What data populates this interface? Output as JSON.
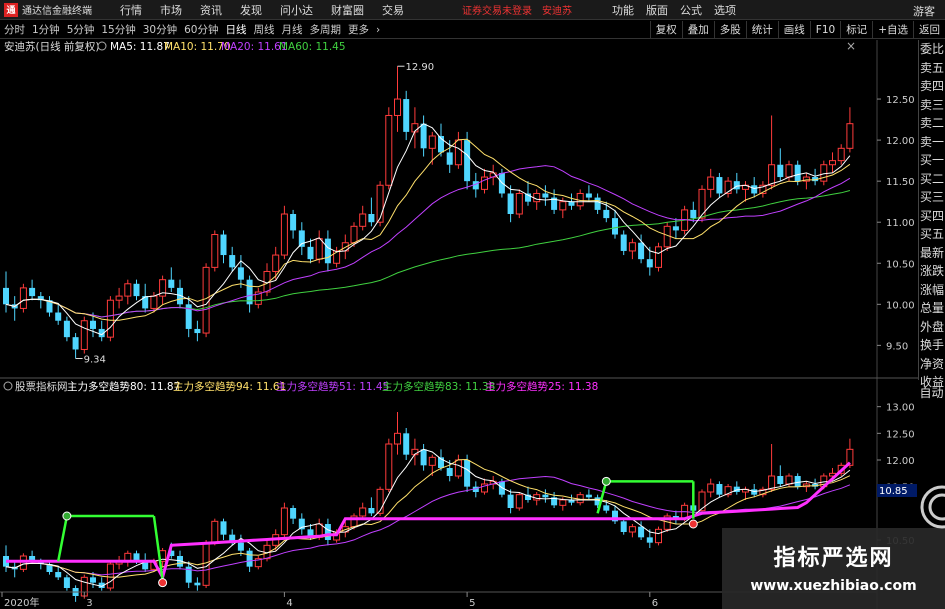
{
  "menu": {
    "app_title": "通达信金融终端",
    "items": [
      "行情",
      "市场",
      "资讯",
      "发现",
      "问小达",
      "财富圈",
      "交易"
    ],
    "trade_login": "证券交易未登录",
    "stock_link": "安迪苏",
    "right_items": [
      "功能",
      "版面",
      "公式",
      "选项"
    ],
    "guest": "游客"
  },
  "toolbar": {
    "periods": [
      "分时",
      "1分钟",
      "5分钟",
      "15分钟",
      "30分钟",
      "60分钟",
      "日线",
      "周线",
      "月线",
      "多周期",
      "更多"
    ],
    "active_period": "日线",
    "right_buttons": [
      "复权",
      "叠加",
      "多股",
      "统计",
      "画线",
      "F10",
      "标记",
      "+自选",
      "返回"
    ]
  },
  "main_legend": {
    "title": "安迪苏(日线 前复权)",
    "ma5": "MA5: 11.87",
    "ma10": "MA10: 11.70",
    "ma20": "MA20: 11.61",
    "ma60": "MA60: 11.45",
    "high_label": "12.90",
    "low_label": "9.34",
    "y_labels": [
      "12.50",
      "12.00",
      "11.50",
      "11.00",
      "10.50",
      "10.00",
      "9.50"
    ]
  },
  "sub_legend": {
    "title": "股票指标网",
    "l1": "主力多空趋势80: 11.87",
    "l2": "主力多空趋势94: 11.61",
    "l3": "主力多空趋势51: 11.45",
    "l4": "主力多空趋势83: 11.38",
    "l5": "主力多空趋势25: 11.38",
    "y_labels": [
      "13.00",
      "12.50",
      "12.00",
      "11.50",
      "10.50"
    ],
    "current_value": "10.85"
  },
  "x_axis": [
    "2020年",
    "3",
    "4",
    "5",
    "6"
  ],
  "sidebar": [
    "委比",
    "卖五",
    "卖四",
    "卖三",
    "卖二",
    "卖一",
    "买一",
    "买二",
    "买三",
    "买四",
    "买五",
    "最新",
    "涨跌",
    "涨幅",
    "总量",
    "外盘",
    "换手",
    "净资",
    "收益"
  ],
  "sub_auto": "自动",
  "watermark": {
    "title": "指标严选网",
    "url": "www.xuezhibiao.com"
  },
  "colors": {
    "up": "#ff3b3b",
    "down": "#4fd6ff",
    "ma5": "#ffffff",
    "ma10": "#ffe06b",
    "ma20": "#c040ff",
    "ma60": "#40d040",
    "magenta": "#ff30ff",
    "green_line": "#33ff33"
  },
  "chart_data": {
    "type": "candlestick",
    "ohlc": [
      [
        10.2,
        10.4,
        9.9,
        10.0
      ],
      [
        10.0,
        10.1,
        9.8,
        9.95
      ],
      [
        9.95,
        10.25,
        9.9,
        10.2
      ],
      [
        10.2,
        10.3,
        10.05,
        10.1
      ],
      [
        10.1,
        10.15,
        9.95,
        10.05
      ],
      [
        10.05,
        10.1,
        9.85,
        9.9
      ],
      [
        9.9,
        10.0,
        9.75,
        9.8
      ],
      [
        9.8,
        9.85,
        9.55,
        9.6
      ],
      [
        9.6,
        9.65,
        9.34,
        9.45
      ],
      [
        9.45,
        9.85,
        9.4,
        9.8
      ],
      [
        9.8,
        9.9,
        9.6,
        9.7
      ],
      [
        9.7,
        9.8,
        9.55,
        9.6
      ],
      [
        9.6,
        10.1,
        9.55,
        10.05
      ],
      [
        10.05,
        10.2,
        9.95,
        10.1
      ],
      [
        10.1,
        10.3,
        10.0,
        10.25
      ],
      [
        10.25,
        10.3,
        10.05,
        10.1
      ],
      [
        10.1,
        10.25,
        9.9,
        9.95
      ],
      [
        9.95,
        10.15,
        9.9,
        10.1
      ],
      [
        10.1,
        10.35,
        10.0,
        10.3
      ],
      [
        10.3,
        10.45,
        10.15,
        10.2
      ],
      [
        10.2,
        10.3,
        9.95,
        10.0
      ],
      [
        10.0,
        10.1,
        9.6,
        9.7
      ],
      [
        9.7,
        9.8,
        9.55,
        9.65
      ],
      [
        9.65,
        10.5,
        9.6,
        10.45
      ],
      [
        10.45,
        10.9,
        10.4,
        10.85
      ],
      [
        10.85,
        10.9,
        10.5,
        10.6
      ],
      [
        10.6,
        10.7,
        10.4,
        10.45
      ],
      [
        10.45,
        10.6,
        10.2,
        10.3
      ],
      [
        10.3,
        10.35,
        9.9,
        10.0
      ],
      [
        10.0,
        10.2,
        9.95,
        10.15
      ],
      [
        10.15,
        10.5,
        10.1,
        10.4
      ],
      [
        10.4,
        10.7,
        10.3,
        10.6
      ],
      [
        10.6,
        11.2,
        10.55,
        11.1
      ],
      [
        11.1,
        11.15,
        10.8,
        10.9
      ],
      [
        10.9,
        11.0,
        10.6,
        10.7
      ],
      [
        10.7,
        10.8,
        10.5,
        10.55
      ],
      [
        10.55,
        10.9,
        10.5,
        10.8
      ],
      [
        10.8,
        10.9,
        10.4,
        10.5
      ],
      [
        10.5,
        10.7,
        10.45,
        10.65
      ],
      [
        10.65,
        10.85,
        10.55,
        10.75
      ],
      [
        10.75,
        11.0,
        10.7,
        10.95
      ],
      [
        10.95,
        11.2,
        10.9,
        11.1
      ],
      [
        11.1,
        11.3,
        10.95,
        11.0
      ],
      [
        11.0,
        11.5,
        10.95,
        11.45
      ],
      [
        11.45,
        12.4,
        11.4,
        12.3
      ],
      [
        12.3,
        12.9,
        12.1,
        12.5
      ],
      [
        12.5,
        12.6,
        12.0,
        12.1
      ],
      [
        12.1,
        12.4,
        11.9,
        12.2
      ],
      [
        12.2,
        12.3,
        11.8,
        11.9
      ],
      [
        11.9,
        12.1,
        11.7,
        12.05
      ],
      [
        12.05,
        12.2,
        11.8,
        11.85
      ],
      [
        11.85,
        12.0,
        11.6,
        11.7
      ],
      [
        11.7,
        12.1,
        11.65,
        12.0
      ],
      [
        12.0,
        12.1,
        11.4,
        11.5
      ],
      [
        11.5,
        11.6,
        11.3,
        11.4
      ],
      [
        11.4,
        11.65,
        11.35,
        11.55
      ],
      [
        11.55,
        11.7,
        11.45,
        11.6
      ],
      [
        11.6,
        11.65,
        11.3,
        11.35
      ],
      [
        11.35,
        11.45,
        11.0,
        11.1
      ],
      [
        11.1,
        11.4,
        11.05,
        11.35
      ],
      [
        11.35,
        11.5,
        11.2,
        11.25
      ],
      [
        11.25,
        11.4,
        11.15,
        11.35
      ],
      [
        11.35,
        11.45,
        11.2,
        11.3
      ],
      [
        11.3,
        11.4,
        11.1,
        11.15
      ],
      [
        11.15,
        11.3,
        11.05,
        11.25
      ],
      [
        11.25,
        11.35,
        11.15,
        11.2
      ],
      [
        11.2,
        11.4,
        11.15,
        11.35
      ],
      [
        11.35,
        11.45,
        11.25,
        11.3
      ],
      [
        11.3,
        11.35,
        11.1,
        11.15
      ],
      [
        11.15,
        11.25,
        11.0,
        11.05
      ],
      [
        11.05,
        11.15,
        10.8,
        10.85
      ],
      [
        10.85,
        10.9,
        10.6,
        10.65
      ],
      [
        10.65,
        10.8,
        10.55,
        10.75
      ],
      [
        10.75,
        10.85,
        10.5,
        10.55
      ],
      [
        10.55,
        10.7,
        10.35,
        10.45
      ],
      [
        10.45,
        10.75,
        10.4,
        10.7
      ],
      [
        10.7,
        11.0,
        10.65,
        10.95
      ],
      [
        10.95,
        11.05,
        10.8,
        10.9
      ],
      [
        10.9,
        11.2,
        10.85,
        11.15
      ],
      [
        11.15,
        11.25,
        11.0,
        11.05
      ],
      [
        11.05,
        11.45,
        11.0,
        11.4
      ],
      [
        11.4,
        11.65,
        11.3,
        11.55
      ],
      [
        11.55,
        11.6,
        11.3,
        11.35
      ],
      [
        11.35,
        11.55,
        11.3,
        11.5
      ],
      [
        11.5,
        11.6,
        11.35,
        11.4
      ],
      [
        11.4,
        11.5,
        11.25,
        11.45
      ],
      [
        11.45,
        11.55,
        11.3,
        11.35
      ],
      [
        11.35,
        11.5,
        11.3,
        11.45
      ],
      [
        11.45,
        12.3,
        11.4,
        11.7
      ],
      [
        11.7,
        11.9,
        11.5,
        11.55
      ],
      [
        11.55,
        11.75,
        11.5,
        11.7
      ],
      [
        11.7,
        11.75,
        11.45,
        11.5
      ],
      [
        11.5,
        11.6,
        11.4,
        11.55
      ],
      [
        11.55,
        11.65,
        11.45,
        11.5
      ],
      [
        11.5,
        11.75,
        11.45,
        11.7
      ],
      [
        11.7,
        11.85,
        11.6,
        11.75
      ],
      [
        11.75,
        11.95,
        11.7,
        11.9
      ],
      [
        11.9,
        12.4,
        11.85,
        12.2
      ]
    ],
    "ylim": [
      9.2,
      13.0
    ],
    "sub_ylim": [
      9.6,
      13.2
    ],
    "x_ticks": {
      "2020年": 0,
      "3": 9,
      "4": 32,
      "5": 53,
      "6": 74
    }
  }
}
